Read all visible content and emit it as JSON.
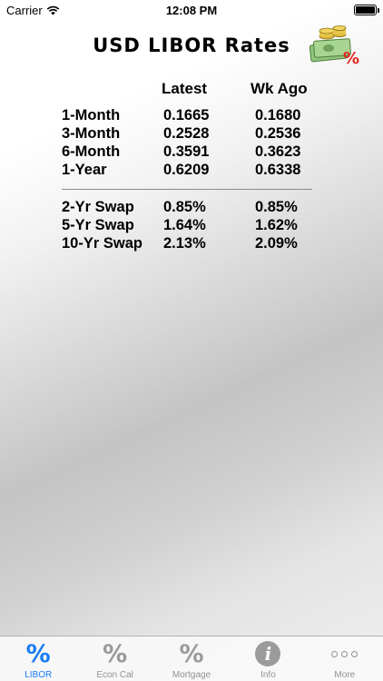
{
  "status_bar": {
    "carrier": "Carrier",
    "time": "12:08 PM"
  },
  "header": {
    "title": "USD LIBOR Rates",
    "logo_icon": "money-percent-icon"
  },
  "table": {
    "columns": [
      "Latest",
      "Wk Ago"
    ],
    "libor_rows": [
      {
        "label": "1-Month",
        "latest": "0.1665",
        "wk_ago": "0.1680"
      },
      {
        "label": "3-Month",
        "latest": "0.2528",
        "wk_ago": "0.2536"
      },
      {
        "label": "6-Month",
        "latest": "0.3591",
        "wk_ago": "0.3623"
      },
      {
        "label": "1-Year",
        "latest": "0.6209",
        "wk_ago": "0.6338"
      }
    ],
    "swap_rows": [
      {
        "label": "2-Yr Swap",
        "latest": "0.85%",
        "wk_ago": "0.85%"
      },
      {
        "label": "5-Yr Swap",
        "latest": "1.64%",
        "wk_ago": "1.62%"
      },
      {
        "label": "10-Yr Swap",
        "latest": "2.13%",
        "wk_ago": "2.09%"
      }
    ]
  },
  "tab_bar": {
    "active_color": "#1a7cf5",
    "tabs": [
      {
        "label": "LIBOR",
        "icon": "percent-icon",
        "glyph": "%",
        "active": true
      },
      {
        "label": "Econ Cal",
        "icon": "percent-icon",
        "glyph": "%",
        "active": false
      },
      {
        "label": "Mortgage",
        "icon": "percent-icon",
        "glyph": "%",
        "active": false
      },
      {
        "label": "Info",
        "icon": "info-icon",
        "glyph": "i",
        "active": false
      },
      {
        "label": "More",
        "icon": "more-dots-icon",
        "glyph": "",
        "active": false
      }
    ]
  }
}
